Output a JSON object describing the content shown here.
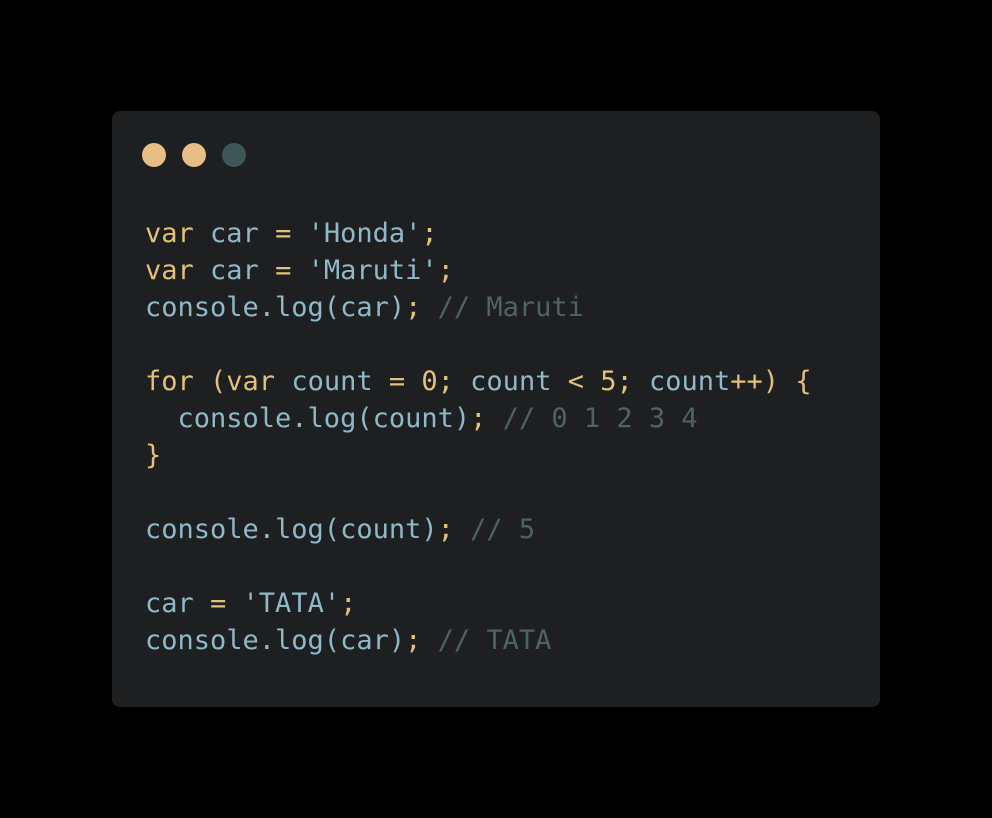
{
  "window": {
    "controls": [
      {
        "name": "close",
        "color": "#e7bf86"
      },
      {
        "name": "minimize",
        "color": "#e7bf86"
      },
      {
        "name": "maximize",
        "color": "#3e5655"
      }
    ]
  },
  "code_lines": [
    [
      {
        "t": "kw",
        "v": "var "
      },
      {
        "t": "id",
        "v": "car "
      },
      {
        "t": "punc",
        "v": "= "
      },
      {
        "t": "str",
        "v": "'Honda'"
      },
      {
        "t": "punc",
        "v": ";"
      }
    ],
    [
      {
        "t": "kw",
        "v": "var "
      },
      {
        "t": "id",
        "v": "car "
      },
      {
        "t": "punc",
        "v": "= "
      },
      {
        "t": "str",
        "v": "'Maruti'"
      },
      {
        "t": "punc",
        "v": ";"
      }
    ],
    [
      {
        "t": "id",
        "v": "console.log(car)"
      },
      {
        "t": "punc",
        "v": "; "
      },
      {
        "t": "comment",
        "v": "// Maruti"
      }
    ],
    [],
    [
      {
        "t": "kw",
        "v": "for "
      },
      {
        "t": "punc",
        "v": "("
      },
      {
        "t": "kw",
        "v": "var "
      },
      {
        "t": "id",
        "v": "count "
      },
      {
        "t": "punc",
        "v": "= "
      },
      {
        "t": "num",
        "v": "0"
      },
      {
        "t": "punc",
        "v": "; "
      },
      {
        "t": "id",
        "v": "count "
      },
      {
        "t": "punc",
        "v": "< "
      },
      {
        "t": "num",
        "v": "5"
      },
      {
        "t": "punc",
        "v": "; "
      },
      {
        "t": "id",
        "v": "count"
      },
      {
        "t": "punc",
        "v": "++) {"
      }
    ],
    [
      {
        "t": "id",
        "v": "  console.log(count)"
      },
      {
        "t": "punc",
        "v": "; "
      },
      {
        "t": "comment",
        "v": "// 0 1 2 3 4"
      }
    ],
    [
      {
        "t": "punc",
        "v": "}"
      }
    ],
    [],
    [
      {
        "t": "id",
        "v": "console.log(count)"
      },
      {
        "t": "punc",
        "v": "; "
      },
      {
        "t": "comment",
        "v": "// 5"
      }
    ],
    [],
    [
      {
        "t": "id",
        "v": "car "
      },
      {
        "t": "punc",
        "v": "= "
      },
      {
        "t": "str",
        "v": "'TATA'"
      },
      {
        "t": "punc",
        "v": ";"
      }
    ],
    [
      {
        "t": "id",
        "v": "console.log(car)"
      },
      {
        "t": "punc",
        "v": "; "
      },
      {
        "t": "comment",
        "v": "// TATA"
      }
    ]
  ]
}
